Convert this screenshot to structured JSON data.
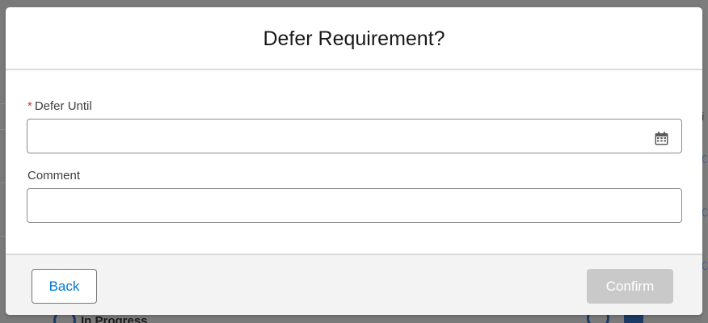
{
  "background": {
    "status_text": "In Progress"
  },
  "modal": {
    "title": "Defer Requirement?",
    "defer_until": {
      "label": "Defer Until",
      "required_mark": "*",
      "value": "",
      "icon": "calendar-icon"
    },
    "comment": {
      "label": "Comment",
      "value": ""
    },
    "footer": {
      "back_label": "Back",
      "confirm_label": "Confirm"
    }
  },
  "colors": {
    "link_blue": "#0176d3",
    "required_red": "#c23934",
    "disabled_button": "#c9c9c9",
    "footer_bg": "#f3f3f3"
  }
}
